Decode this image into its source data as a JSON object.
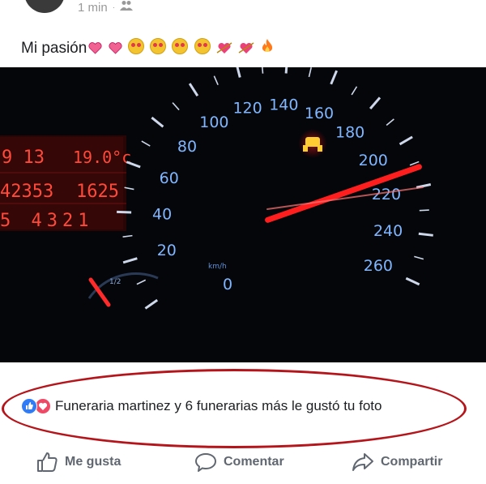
{
  "post": {
    "time": "1 min",
    "separator": "·",
    "caption": "Mi pasión"
  },
  "dashboard": {
    "speed_labels": [
      "20",
      "40",
      "60",
      "80",
      "100",
      "120",
      "140",
      "160",
      "180",
      "200",
      "220",
      "240",
      "260"
    ],
    "speed_unit": "km/h",
    "needle_kmh": 212,
    "lcd_line1_left": "9 13",
    "lcd_line1_right": "19.0°c",
    "lcd_line2_left": "42353",
    "lcd_line2_right": "1625",
    "lcd_line3": "5 4321",
    "zero_label": "0",
    "fuel_mark": "1/2"
  },
  "reactions": {
    "liked_text": "Funeraria martinez y 6 funerarias más le gustó tu foto",
    "like_color": "#2f7cf6",
    "love_color": "#ee4a66",
    "highlight_color": "#b5151a"
  },
  "actions": {
    "like": "Me gusta",
    "comment": "Comentar",
    "share": "Compartir"
  }
}
